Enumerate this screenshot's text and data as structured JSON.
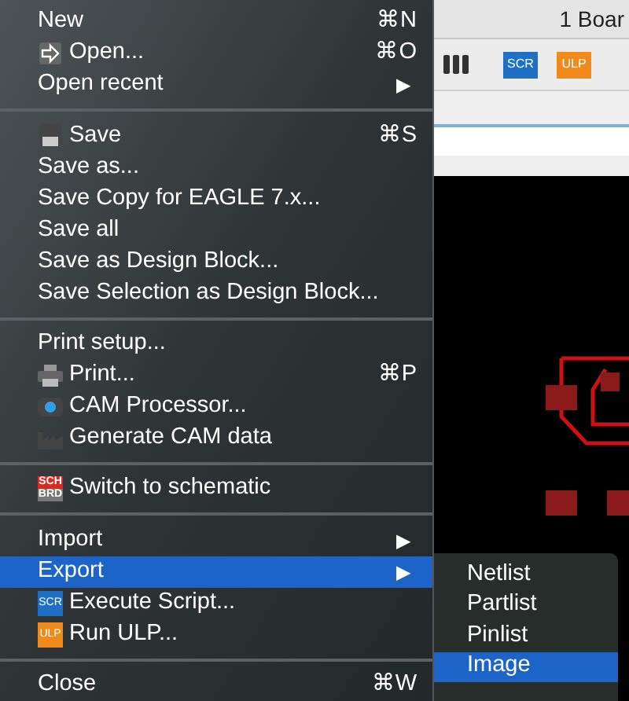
{
  "window": {
    "title": "1 Boar"
  },
  "toolbar": [
    {
      "kind": "switches"
    },
    {
      "kind": "badge",
      "label": "SCR",
      "color": "#1f6fc4"
    },
    {
      "kind": "badge",
      "label": "ULP",
      "color": "#f08a1c"
    }
  ],
  "menu": [
    {
      "kind": "item",
      "label": "New",
      "shortcut": "⌘N",
      "selected": false
    },
    {
      "kind": "open",
      "label": "Open...",
      "shortcut": "⌘O",
      "selected": false
    },
    {
      "kind": "item",
      "label": "Open recent",
      "arrow": "▶",
      "selected": false
    },
    {
      "kind": "separator"
    },
    {
      "kind": "save",
      "label": "Save",
      "shortcut": "⌘S",
      "selected": false
    },
    {
      "kind": "item",
      "label": "Save as...",
      "selected": false
    },
    {
      "kind": "item",
      "label": "Save Copy for EAGLE 7.x...",
      "selected": false
    },
    {
      "kind": "item",
      "label": "Save all",
      "selected": false
    },
    {
      "kind": "item",
      "label": "Save as Design Block...",
      "selected": false
    },
    {
      "kind": "item",
      "label": "Save Selection as Design Block...",
      "selected": false
    },
    {
      "kind": "separator"
    },
    {
      "kind": "item",
      "label": "Print setup...",
      "selected": false
    },
    {
      "kind": "print",
      "label": "Print...",
      "shortcut": "⌘P",
      "selected": false
    },
    {
      "kind": "cam",
      "label": "CAM Processor...",
      "selected": false
    },
    {
      "kind": "factory",
      "label": "Generate CAM data",
      "selected": false
    },
    {
      "kind": "separator"
    },
    {
      "kind": "switch",
      "icon_text": [
        "SCH",
        "BRD"
      ],
      "label": "Switch to schematic",
      "selected": false
    },
    {
      "kind": "separator"
    },
    {
      "kind": "item",
      "label": "Import",
      "arrow": "▶",
      "selected": false
    },
    {
      "kind": "item",
      "label": "Export",
      "arrow": "▶",
      "selected": true
    },
    {
      "kind": "badge",
      "icon_text": [
        "SCR"
      ],
      "color": "#1f6fc4",
      "label": "Execute Script...",
      "selected": false
    },
    {
      "kind": "badge",
      "icon_text": [
        "ULP"
      ],
      "color": "#f08a1c",
      "label": "Run ULP...",
      "selected": false
    },
    {
      "kind": "separator"
    },
    {
      "kind": "item",
      "label": "Close",
      "shortcut": "⌘W",
      "selected": false
    }
  ],
  "submenu": [
    {
      "label": "Netlist",
      "selected": false
    },
    {
      "label": "Partlist",
      "selected": false
    },
    {
      "label": "Pinlist",
      "selected": false
    },
    {
      "label": "Image",
      "selected": true
    }
  ]
}
